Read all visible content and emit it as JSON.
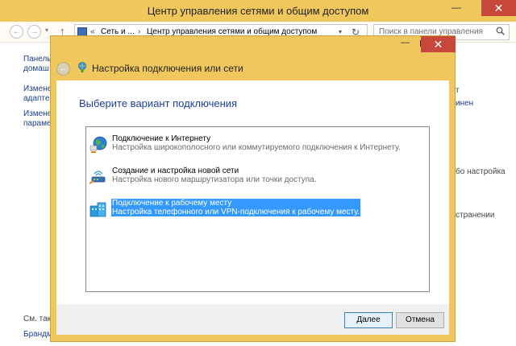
{
  "main_window": {
    "title": "Центр управления сетями и общим доступом",
    "min_symbol": "—",
    "close_symbol": "✕"
  },
  "address_bar": {
    "back_symbol": "←",
    "forward_symbol": "→",
    "dropdown_symbol": "▾",
    "up_symbol": "↑",
    "overflow_symbol": "«",
    "crumb_1": "Сеть и ...",
    "crumb_sep": "›",
    "crumb_2": "Центр управления сетями и общим доступом",
    "refresh_symbol": "↻",
    "search_placeholder": "Поиск в панели управления"
  },
  "background": {
    "left_link_1a": "Панель",
    "left_link_1b": "домаш",
    "left_link_2a": "Измене",
    "left_link_2b": "адаптер",
    "left_link_3a": "Измене",
    "left_link_3b": "парамет",
    "see_also": "См. так",
    "firewall": "Брандму",
    "right_text_1": "т",
    "right_link_1": "инен",
    "right_text_2": "бо настройка",
    "right_text_3": "странении"
  },
  "dialog": {
    "title": "Настройка подключения или сети",
    "min_symbol": "—",
    "close_symbol": "✕",
    "back_symbol": "←",
    "heading": "Выберите вариант подключения",
    "options": [
      {
        "title": "Подключение к Интернету",
        "desc": "Настройка широкополосного или коммутируемого подключения к Интернету.",
        "icon": "globe-icon"
      },
      {
        "title": "Создание и настройка новой сети",
        "desc": "Настройка нового маршрутизатора или точки доступа.",
        "icon": "router-icon"
      },
      {
        "title": "Подключение к рабочему месту",
        "desc": "Настройка телефонного или VPN-подключения к рабочему месту.",
        "icon": "workplace-icon",
        "selected": true
      }
    ],
    "next_button": "Далее",
    "cancel_button": "Отмена"
  }
}
